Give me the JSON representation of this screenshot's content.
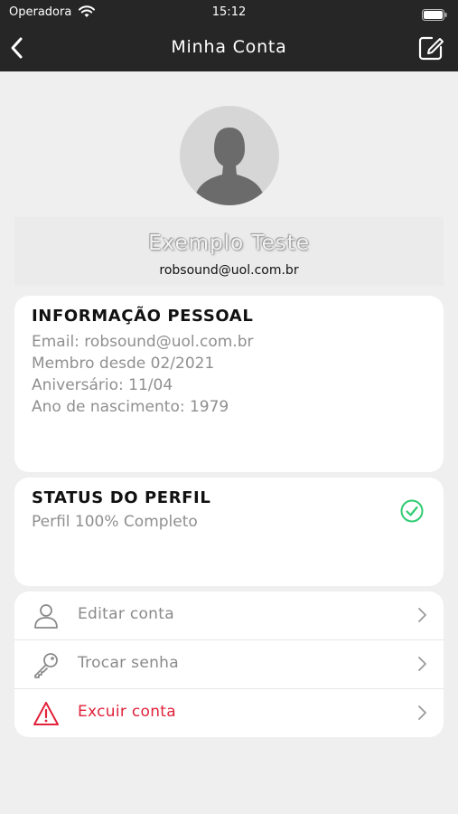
{
  "status_bar": {
    "carrier": "Operadora",
    "time": "15:12",
    "icons": [
      "wifi-icon",
      "battery-icon"
    ]
  },
  "nav": {
    "title": "Minha Conta",
    "icons": [
      "back-arrow-icon",
      "edit-icon"
    ]
  },
  "profile": {
    "avatar_icon": "person-silhouette-icon",
    "name": "Exemplo Teste",
    "email": "robsound@uol.com.br"
  },
  "personal_info": {
    "title": "INFORMAÇÃO PESSOAL",
    "lines": [
      "Email: robsound@uol.com.br",
      "Membro desde 02/2021",
      "Aniversário: 11/04",
      "Ano de nascimento: 1979"
    ]
  },
  "profile_status": {
    "title": "STATUS DO PERFIL",
    "text": "Perfil 100% Completo",
    "completion_percent": 100,
    "icon": "check-circle-icon",
    "icon_color": "#2ecc71"
  },
  "menu": {
    "items": [
      {
        "label": "Editar conta",
        "icon": "user-icon"
      },
      {
        "label": "Trocar senha",
        "icon": "key-icon"
      },
      {
        "label": "Excuir conta",
        "icon": "warning-icon",
        "color": "#e0223a"
      }
    ]
  },
  "colors": {
    "bar_background": "#262626",
    "page_background": "#efefef",
    "danger": "#e0223a",
    "success": "#2ecc71"
  }
}
